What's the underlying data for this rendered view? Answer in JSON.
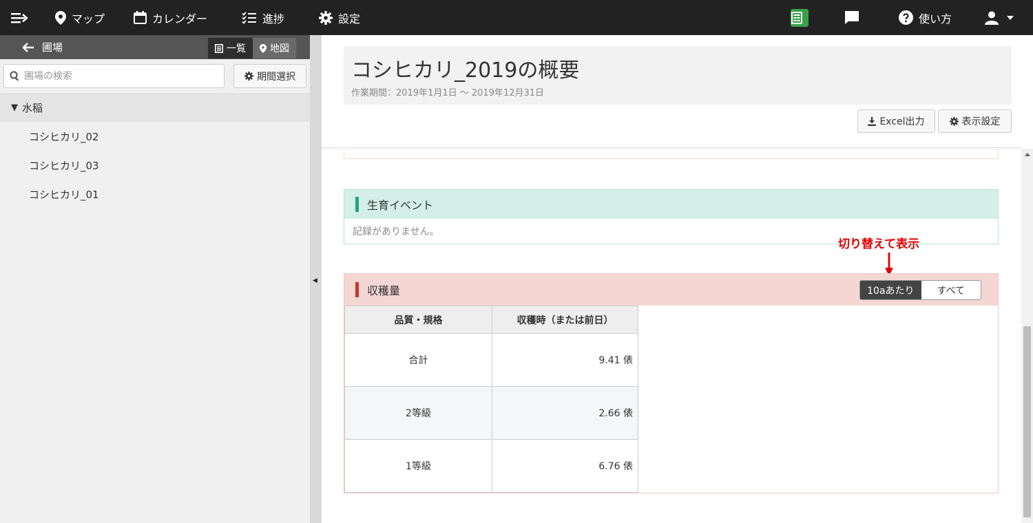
{
  "nav": {
    "menu_icon": "menu-arrow-icon",
    "items": [
      {
        "label": "マップ",
        "icon": "map-pin-icon"
      },
      {
        "label": "カレンダー",
        "icon": "calendar-icon"
      },
      {
        "label": "進捗",
        "icon": "checklist-icon"
      },
      {
        "label": "設定",
        "icon": "gear-icon"
      }
    ],
    "right": {
      "help_label": "使い方"
    }
  },
  "sidebar": {
    "title": "圃場",
    "view_list": "一覧",
    "view_map": "地図",
    "search_placeholder": "圃場の検索",
    "period_button": "期間選択",
    "group": "水稲",
    "items": [
      "コシヒカリ_02",
      "コシヒカリ_03",
      "コシヒカリ_01"
    ]
  },
  "main": {
    "title": "コシヒカリ_2019の概要",
    "period": "作業期間：2019年1月1日 〜 2019年12月31日",
    "excel_button": "Excel出力",
    "display_settings_button": "表示設定",
    "growth": {
      "title": "生育イベント",
      "empty": "記録がありません。"
    },
    "harvest": {
      "title": "収穫量",
      "toggle_per10a": "10aあたり",
      "toggle_all": "すべて",
      "columns": [
        "品質・規格",
        "収穫時（または前日）"
      ],
      "rows": [
        {
          "quality": "合計",
          "value": "9.41 俵"
        },
        {
          "quality": "2等級",
          "value": "2.66 俵"
        },
        {
          "quality": "1等級",
          "value": "6.76 俵"
        }
      ]
    },
    "annotation": "切り替えて表示"
  },
  "colors": {
    "topbar": "#222222",
    "growth_accent": "#20a878",
    "harvest_accent": "#c0392b",
    "annotation": "#e00000"
  }
}
